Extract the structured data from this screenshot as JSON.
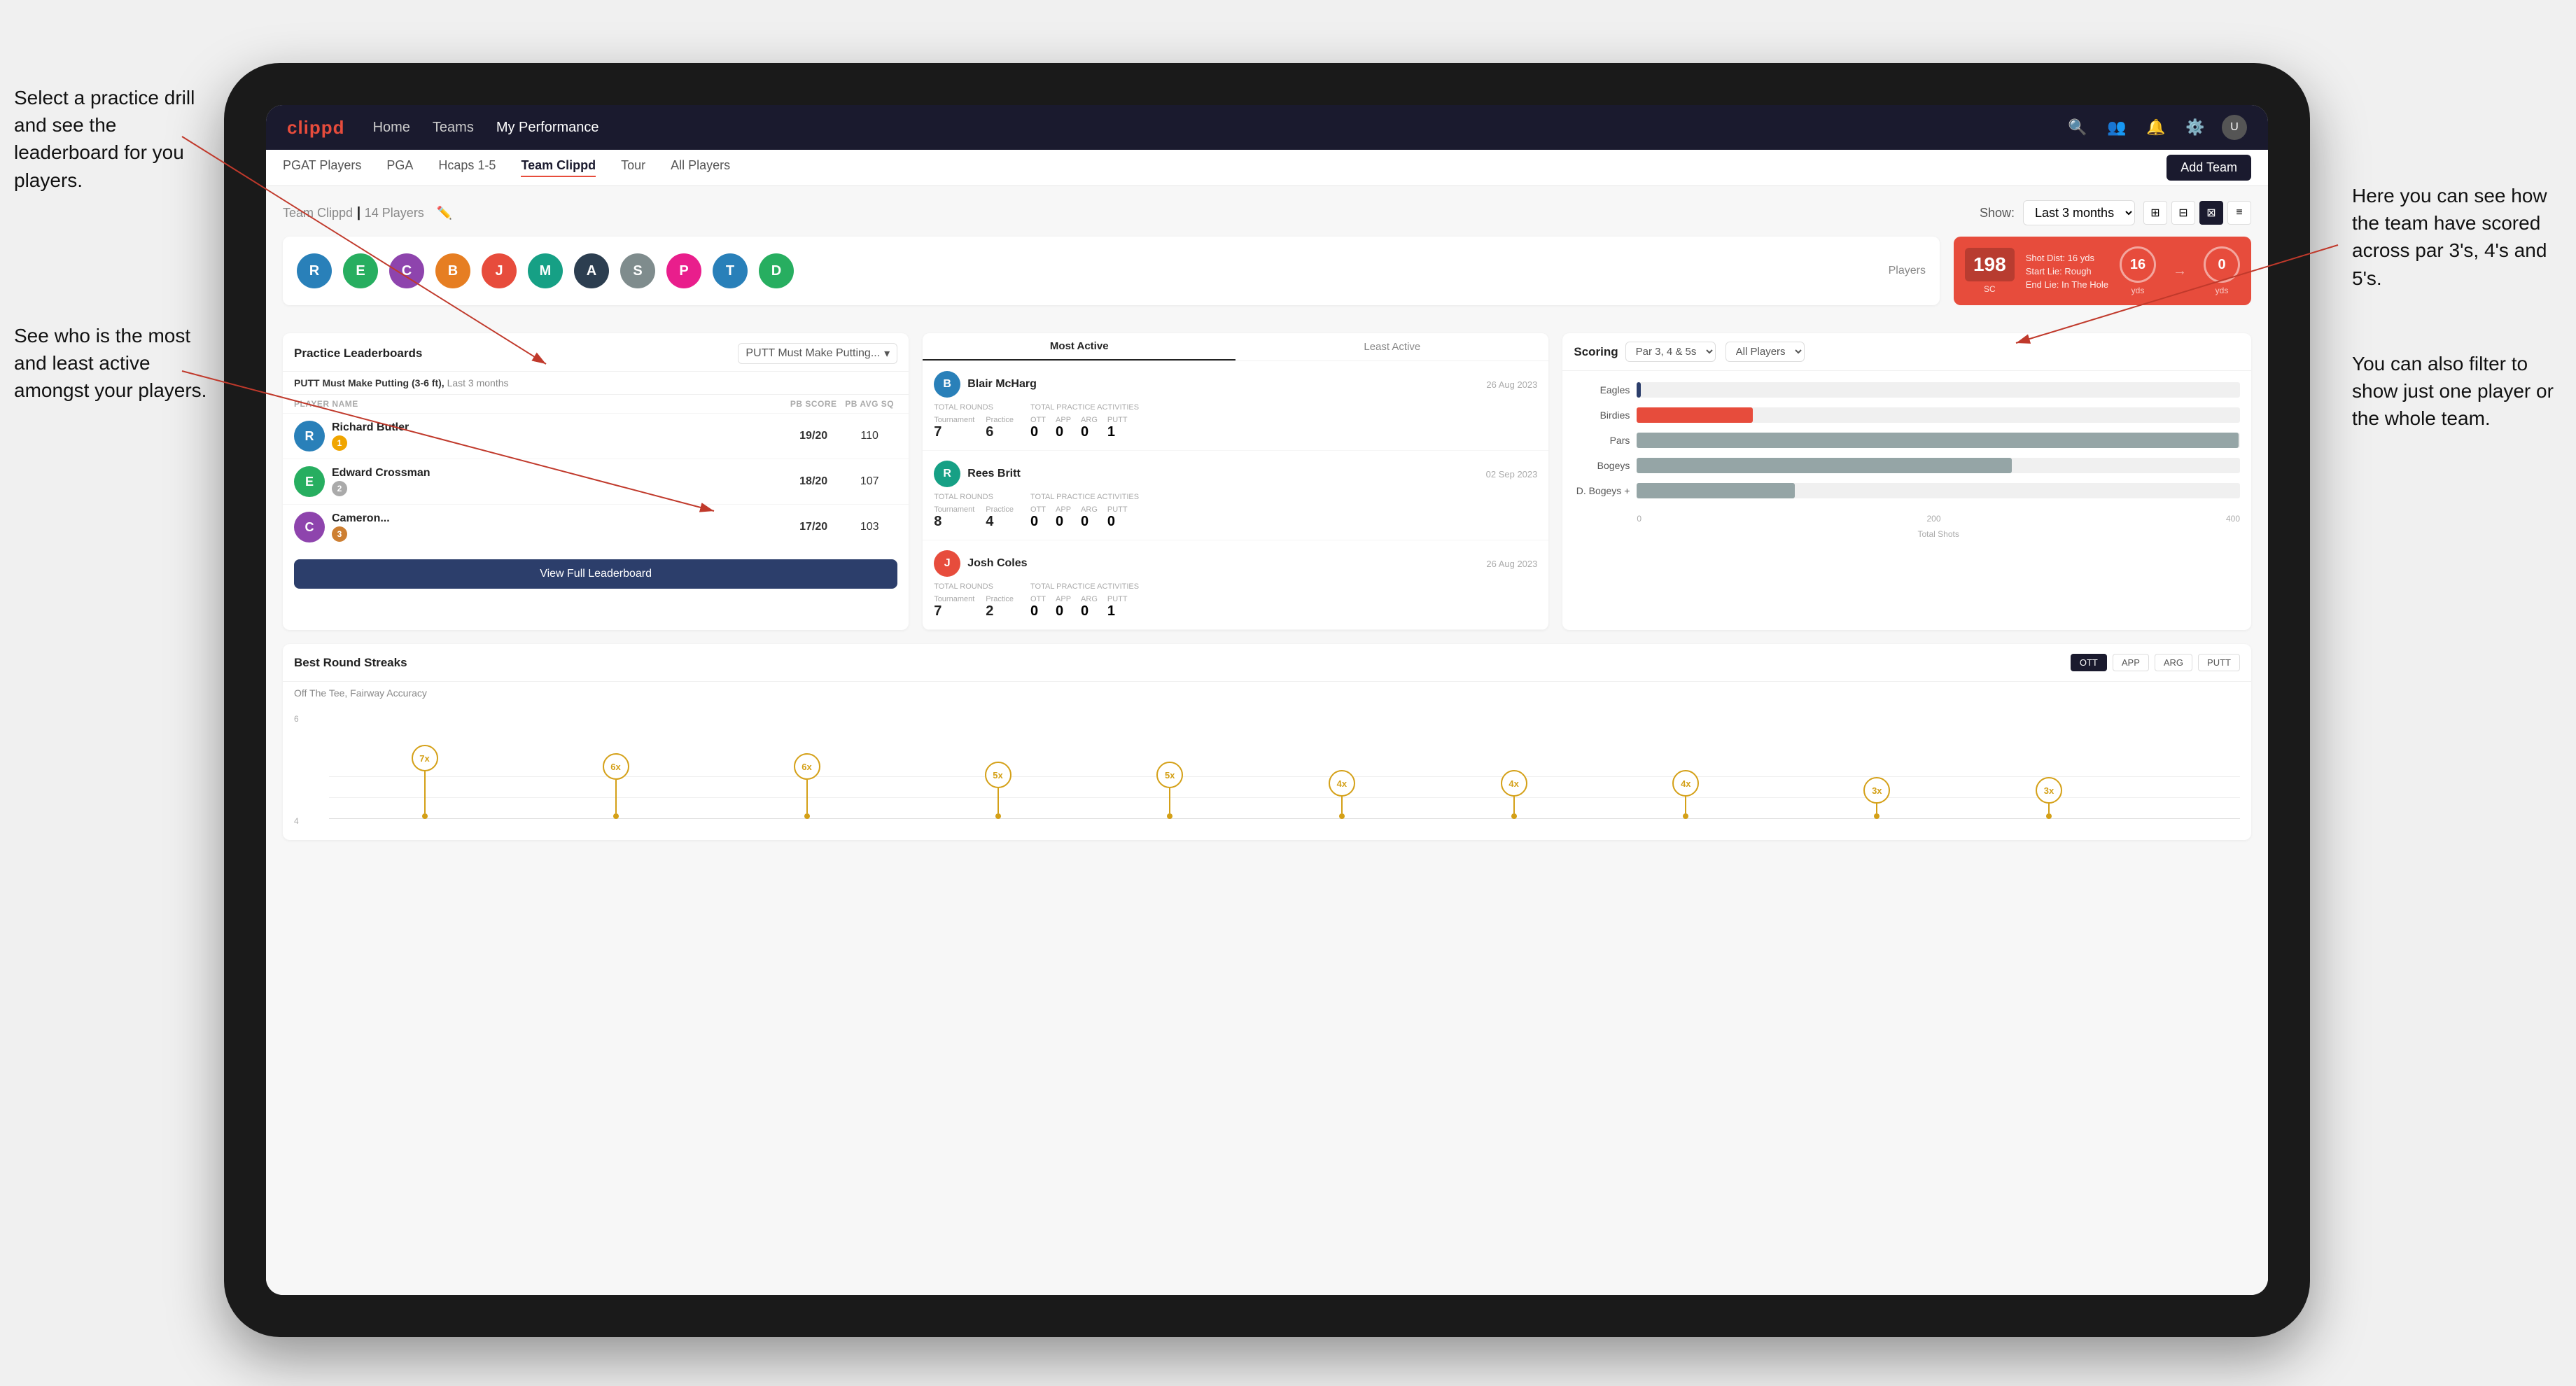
{
  "annotations": {
    "left_top": "Select a practice drill and see the leaderboard for you players.",
    "left_bottom": "See who is the most and least active amongst your players.",
    "right_top": "Here you can see how the team have scored across par 3's, 4's and 5's.",
    "right_bottom": "You can also filter to show just one player or the whole team."
  },
  "navbar": {
    "logo": "clippd",
    "links": [
      "Home",
      "Teams",
      "My Performance"
    ],
    "active_link": "Teams"
  },
  "subnav": {
    "items": [
      "PGAT Players",
      "PGA",
      "Hcaps 1-5",
      "Team Clippd",
      "Tour",
      "All Players"
    ],
    "active_item": "Team Clippd",
    "add_btn": "Add Team"
  },
  "team_header": {
    "name": "Team Clippd",
    "count": "14 Players",
    "show_label": "Show:",
    "show_value": "Last 3 months",
    "view_options": [
      "grid-2",
      "grid-3",
      "grid-4",
      "list"
    ]
  },
  "players": [
    {
      "initials": "R",
      "color": "av-blue"
    },
    {
      "initials": "E",
      "color": "av-green"
    },
    {
      "initials": "C",
      "color": "av-purple"
    },
    {
      "initials": "B",
      "color": "av-orange"
    },
    {
      "initials": "J",
      "color": "av-red"
    },
    {
      "initials": "M",
      "color": "av-teal"
    },
    {
      "initials": "A",
      "color": "av-dark"
    },
    {
      "initials": "S",
      "color": "av-grey"
    },
    {
      "initials": "P",
      "color": "av-pink"
    },
    {
      "initials": "T",
      "color": "av-blue"
    },
    {
      "initials": "D",
      "color": "av-green"
    }
  ],
  "players_label": "Players",
  "highlight_card": {
    "badge": "198",
    "badge_sub": "SC",
    "stat1_label": "Shot Dist: 16 yds",
    "stat2_label": "Start Lie: Rough",
    "stat3_label": "End Lie: In The Hole",
    "circle1_val": "16",
    "circle1_label": "yds",
    "circle2_val": "0",
    "circle2_label": "yds"
  },
  "practice_leaderboards": {
    "title": "Practice Leaderboards",
    "dropdown_label": "PUTT Must Make Putting...",
    "subtitle_drill": "PUTT Must Make Putting (3-6 ft),",
    "subtitle_period": "Last 3 months",
    "col_player": "PLAYER NAME",
    "col_score": "PB SCORE",
    "col_avg": "PB AVG SQ",
    "players": [
      {
        "name": "Richard Butler",
        "score": "19/20",
        "avg": "110",
        "badge": "gold",
        "badge_num": "1",
        "color": "av-blue"
      },
      {
        "name": "Edward Crossman",
        "score": "18/20",
        "avg": "107",
        "badge": "silver",
        "badge_num": "2",
        "color": "av-green"
      },
      {
        "name": "Cameron...",
        "score": "17/20",
        "avg": "103",
        "badge": "bronze",
        "badge_num": "3",
        "color": "av-purple"
      }
    ],
    "view_btn": "View Full Leaderboard"
  },
  "activity": {
    "title": "Most Active",
    "toggle_most": "Most Active",
    "toggle_least": "Least Active",
    "players": [
      {
        "name": "Blair McHarg",
        "date": "26 Aug 2023",
        "tournament_rounds": "7",
        "practice_rounds": "6",
        "ott": "0",
        "app": "0",
        "arg": "0",
        "putt": "1",
        "color": "av-blue"
      },
      {
        "name": "Rees Britt",
        "date": "02 Sep 2023",
        "tournament_rounds": "8",
        "practice_rounds": "4",
        "ott": "0",
        "app": "0",
        "arg": "0",
        "putt": "0",
        "color": "av-teal"
      },
      {
        "name": "Josh Coles",
        "date": "26 Aug 2023",
        "tournament_rounds": "7",
        "practice_rounds": "2",
        "ott": "0",
        "app": "0",
        "arg": "0",
        "putt": "1",
        "color": "av-red"
      }
    ],
    "total_rounds_label": "Total Rounds",
    "tournament_label": "Tournament",
    "practice_label": "Practice",
    "total_practice_label": "Total Practice Activities",
    "ott_label": "OTT",
    "app_label": "APP",
    "arg_label": "ARG",
    "putt_label": "PUTT"
  },
  "scoring": {
    "title": "Scoring",
    "filter_par": "Par 3, 4 & 5s",
    "filter_players": "All Players",
    "bars": [
      {
        "label": "Eagles",
        "value": 3,
        "max": 500,
        "color": "#2c3e6b"
      },
      {
        "label": "Birdies",
        "value": 96,
        "max": 500,
        "color": "#e74c3c"
      },
      {
        "label": "Pars",
        "value": 499,
        "max": 500,
        "color": "#95a5a6"
      },
      {
        "label": "Bogeys",
        "value": 311,
        "max": 500,
        "color": "#95a5a6"
      },
      {
        "label": "D. Bogeys +",
        "value": 131,
        "max": 500,
        "color": "#95a5a6"
      }
    ],
    "x_labels": [
      "0",
      "200",
      "400"
    ],
    "x_axis_label": "Total Shots"
  },
  "streaks": {
    "title": "Best Round Streaks",
    "filters": [
      "OTT",
      "APP",
      "ARG",
      "PUTT"
    ],
    "active_filter": "OTT",
    "subtitle": "Off The Tee, Fairway Accuracy",
    "points": [
      {
        "x_pct": 5,
        "y_pct": 15,
        "stem_h": 50,
        "label": "7x"
      },
      {
        "x_pct": 16,
        "y_pct": 25,
        "stem_h": 40,
        "label": "6x"
      },
      {
        "x_pct": 27,
        "y_pct": 25,
        "stem_h": 40,
        "label": "6x"
      },
      {
        "x_pct": 38,
        "y_pct": 40,
        "stem_h": 30,
        "label": "5x"
      },
      {
        "x_pct": 49,
        "y_pct": 40,
        "stem_h": 30,
        "label": "5x"
      },
      {
        "x_pct": 58,
        "y_pct": 55,
        "stem_h": 20,
        "label": "4x"
      },
      {
        "x_pct": 67,
        "y_pct": 55,
        "stem_h": 20,
        "label": "4x"
      },
      {
        "x_pct": 76,
        "y_pct": 55,
        "stem_h": 20,
        "label": "4x"
      },
      {
        "x_pct": 84,
        "y_pct": 70,
        "stem_h": 12,
        "label": "3x"
      },
      {
        "x_pct": 92,
        "y_pct": 70,
        "stem_h": 12,
        "label": "3x"
      }
    ]
  }
}
